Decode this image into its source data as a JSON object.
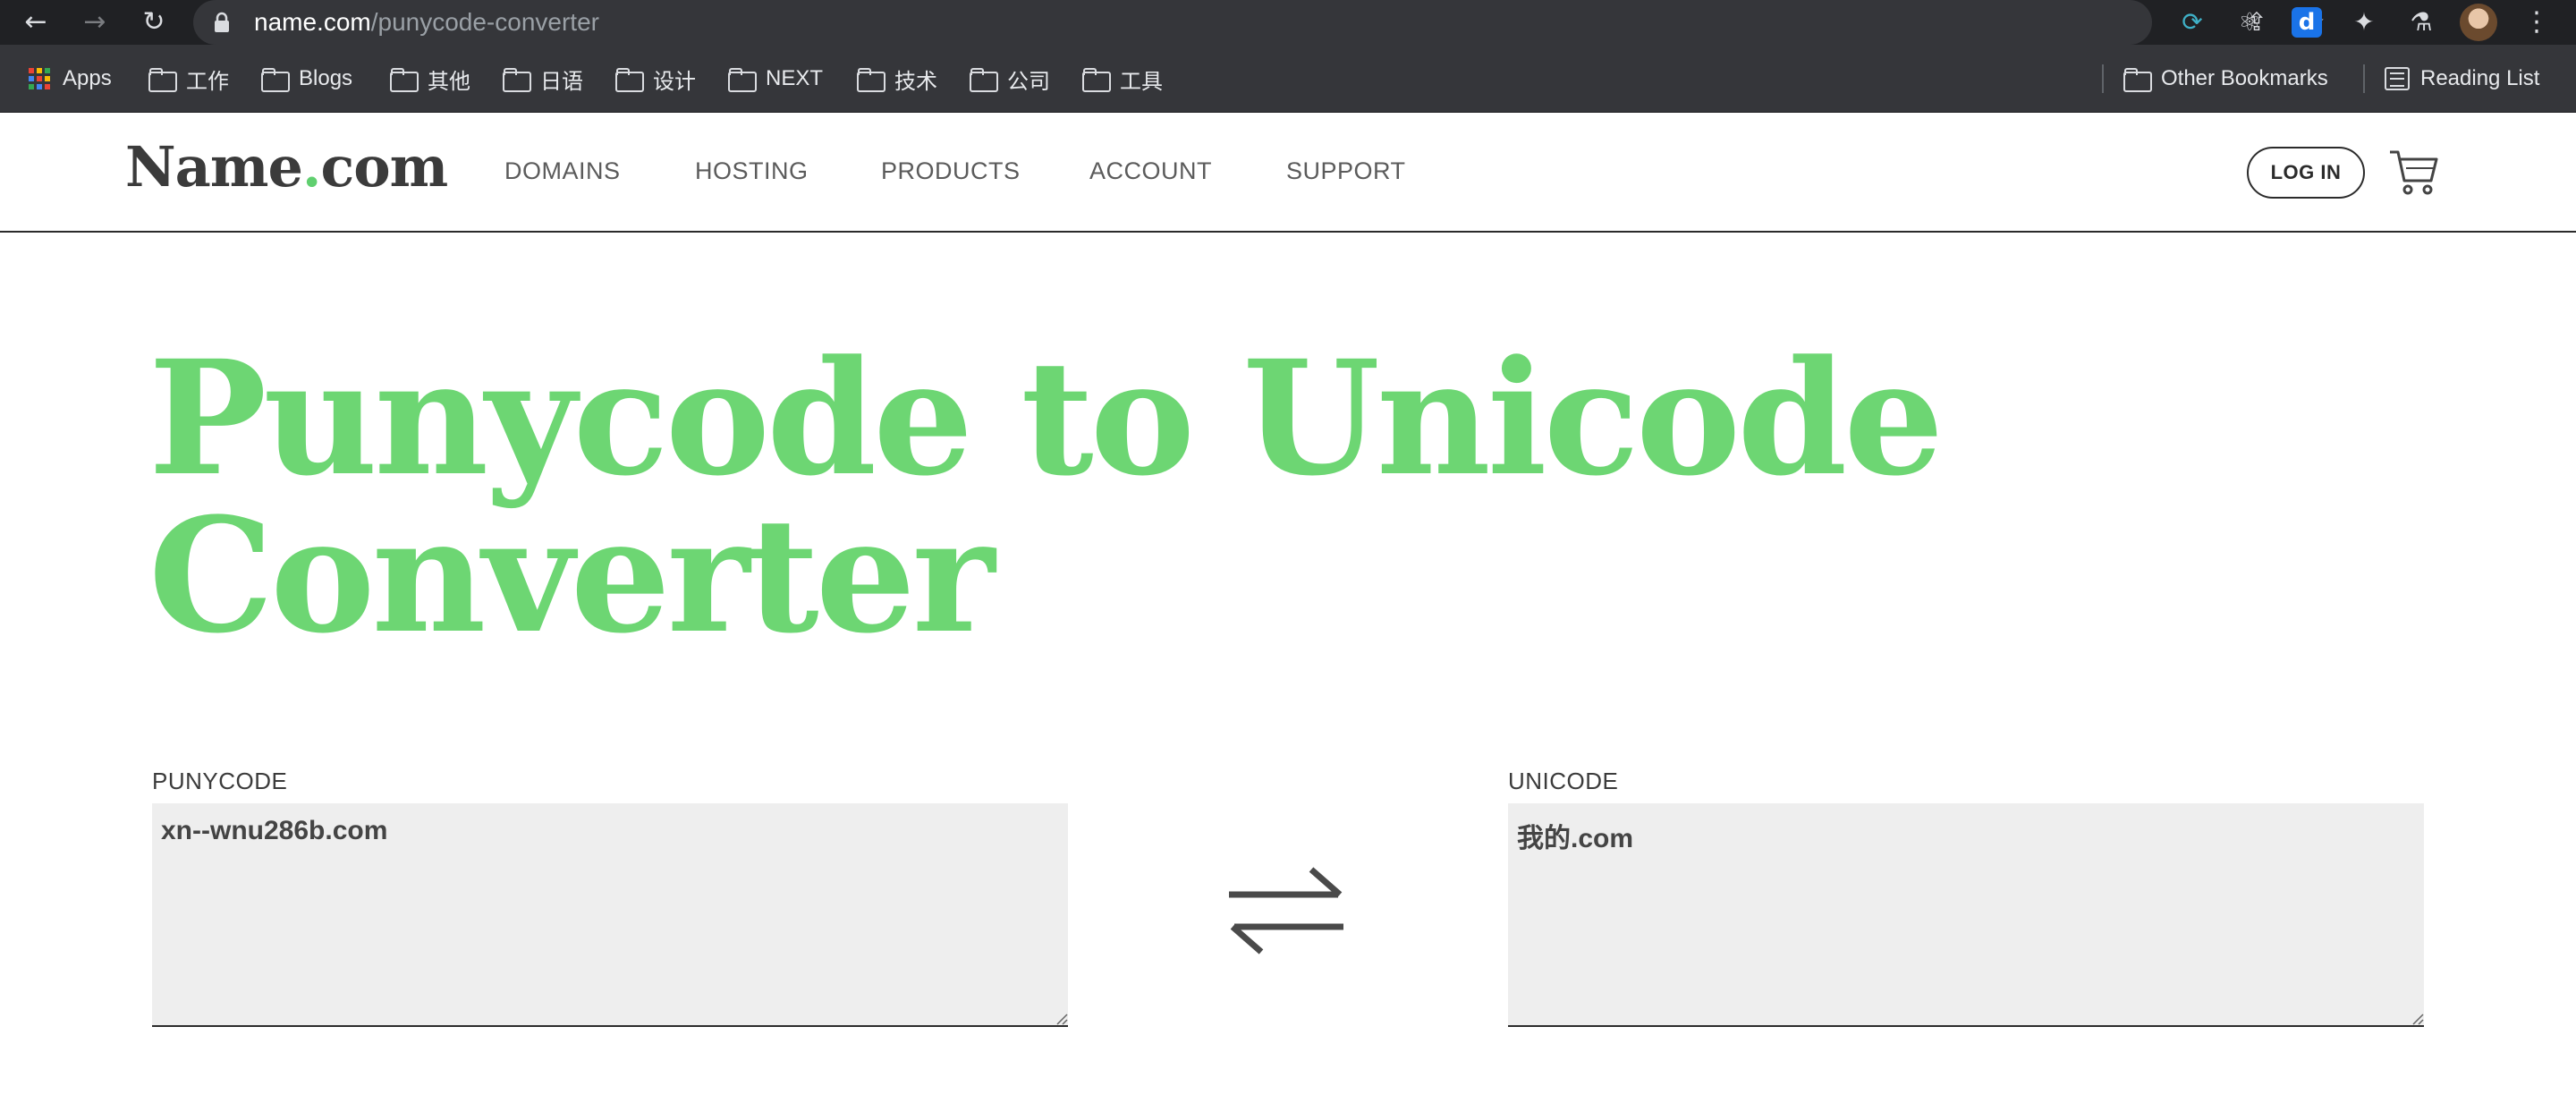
{
  "browser": {
    "url_host": "name.com",
    "url_path": "/punycode-converter",
    "bookmarks": [
      {
        "label": "Apps",
        "icon": "apps-icon"
      },
      {
        "label": "工作",
        "icon": "folder-icon"
      },
      {
        "label": "Blogs",
        "icon": "folder-icon"
      },
      {
        "label": "其他",
        "icon": "folder-icon"
      },
      {
        "label": "日语",
        "icon": "folder-icon"
      },
      {
        "label": "设计",
        "icon": "folder-icon"
      },
      {
        "label": "NEXT",
        "icon": "folder-icon"
      },
      {
        "label": "技术",
        "icon": "folder-icon"
      },
      {
        "label": "公司",
        "icon": "folder-icon"
      },
      {
        "label": "工具",
        "icon": "folder-icon"
      }
    ],
    "other_bookmarks": "Other Bookmarks",
    "reading_list": "Reading List"
  },
  "site": {
    "logo_main": "Name",
    "logo_dot": ".",
    "logo_tld": "com",
    "nav": [
      "DOMAINS",
      "HOSTING",
      "PRODUCTS",
      "ACCOUNT",
      "SUPPORT"
    ],
    "login_label": "LOG IN"
  },
  "converter": {
    "title_line1": "Punycode to Unicode",
    "title_line2": "Converter",
    "punycode_label": "PUNYCODE",
    "punycode_value": "xn--wnu286b.com",
    "unicode_label": "UNICODE",
    "unicode_value": "我的.com"
  },
  "colors": {
    "brand_green": "#6dd673",
    "chrome_dark": "#202124",
    "bookmarks_bar": "#35363a",
    "input_bg": "#eeeeee"
  }
}
